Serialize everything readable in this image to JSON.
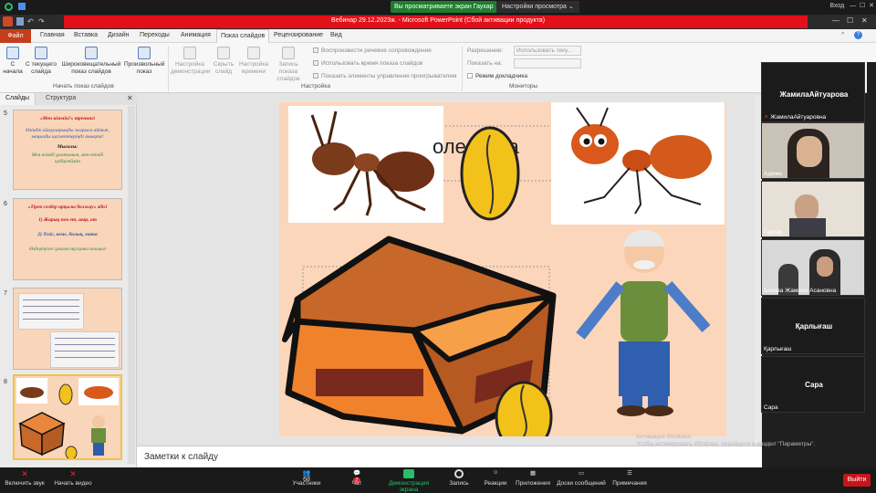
{
  "zoom_top": {
    "sharing_label": "Вы просматриваете экран Гаухар",
    "view_options_label": "Настройки просмотра",
    "login": "Вход",
    "minimize": "—",
    "maximize": "☐",
    "close": "✕"
  },
  "ppt": {
    "window_title": "Вебинар 29.12.2023ж.  -  Microsoft PowerPoint (Сбой активации продукта)",
    "file_tab": "Файл",
    "tabs": [
      "Главная",
      "Вставка",
      "Дизайн",
      "Переходы",
      "Анимация",
      "Показ слайдов",
      "Рецензирование",
      "Вид"
    ],
    "active_tab": "Показ слайдов",
    "ribbon": {
      "from_start": "С начала",
      "from_current": "С текущего слайда",
      "broadcast": "Широковещательный показ слайдов",
      "custom_show": "Произвольный показ",
      "group_start": "Начать показ слайдов",
      "setup": "Настройка демонстрации",
      "hide": "Скрыть слайд",
      "rehearse": "Настройка времени",
      "record": "Запись показа слайдов",
      "play_narration": "Воспроизвести речевое сопровождение",
      "use_timings": "Использовать время показа слайдов",
      "show_controls": "Показать элементы управления проигрывателем",
      "group_setup": "Настройка",
      "resolution_label": "Разрешение:",
      "resolution_value": "Использовать теку...",
      "show_on_label": "Показать на:",
      "presenter_view": "Режим докладчика",
      "group_monitors": "Мониторы"
    },
    "pane_tabs": [
      "Слайды",
      "Структура"
    ],
    "pane_close": "✕",
    "thumbnails": [
      {
        "num": "5",
        "lines": [
          "«Мен кіммін?» тренингі",
          "Өзіндік ойлауларыңды жарыса айтып, маңызды қасиеттеріңді анықта!",
          "Мысалы:",
          "Мен өзімді ұнатамын, мен өзімді қадірлеймін"
        ]
      },
      {
        "num": "6",
        "lines": [
          "«Тірек сөздер арқылы болжау» әдісі",
          "1) Жарық пен ет, шар, от",
          "2) Тегіс, кеме, балық, мата",
          "Өздеріңізге ұнаған нұсқаны алыңыз"
        ]
      },
      {
        "num": "7",
        "lines": []
      },
      {
        "num": "8",
        "lines": []
      }
    ],
    "slide_title_partial": "оле к сла",
    "notes_placeholder": "Заметки к слайду"
  },
  "participants": {
    "speaker_top": "ЖамилаАйтуарова",
    "speaker_top_label": "ЖамилаАйтуаровна",
    "tiles": [
      {
        "name": "Админ"
      },
      {
        "name": "Гаухар"
      },
      {
        "name": "Бекова  Жамиля Асановна"
      },
      {
        "big": "Қарлығаш",
        "name": "Қарлығаш"
      },
      {
        "big": "Сара",
        "name": "Сара"
      }
    ]
  },
  "watermark": [
    "Активация Windows",
    "Чтобы активировать Windows, перейдите в раздел \"Параметры\"."
  ],
  "zoom_bottom": {
    "mute": "Включить звук",
    "video": "Начать видео",
    "participants": "Участники",
    "participants_count": "68",
    "chat": "Чат",
    "chat_badge": "7",
    "share": "Демонстрация экрана",
    "record": "Запись",
    "reactions": "Реакции",
    "apps": "Приложения",
    "whiteboards": "Доски сообщений",
    "notes": "Примечания",
    "leave": "Выйти"
  },
  "colors": {
    "zoom_bg": "#1a1a1a",
    "ppt_red": "#e3101a",
    "ppt_file": "#c43e1c",
    "slide_bg": "#fcd6bb",
    "share_green": "#1e7e2e",
    "leave_red": "#c4161c"
  }
}
